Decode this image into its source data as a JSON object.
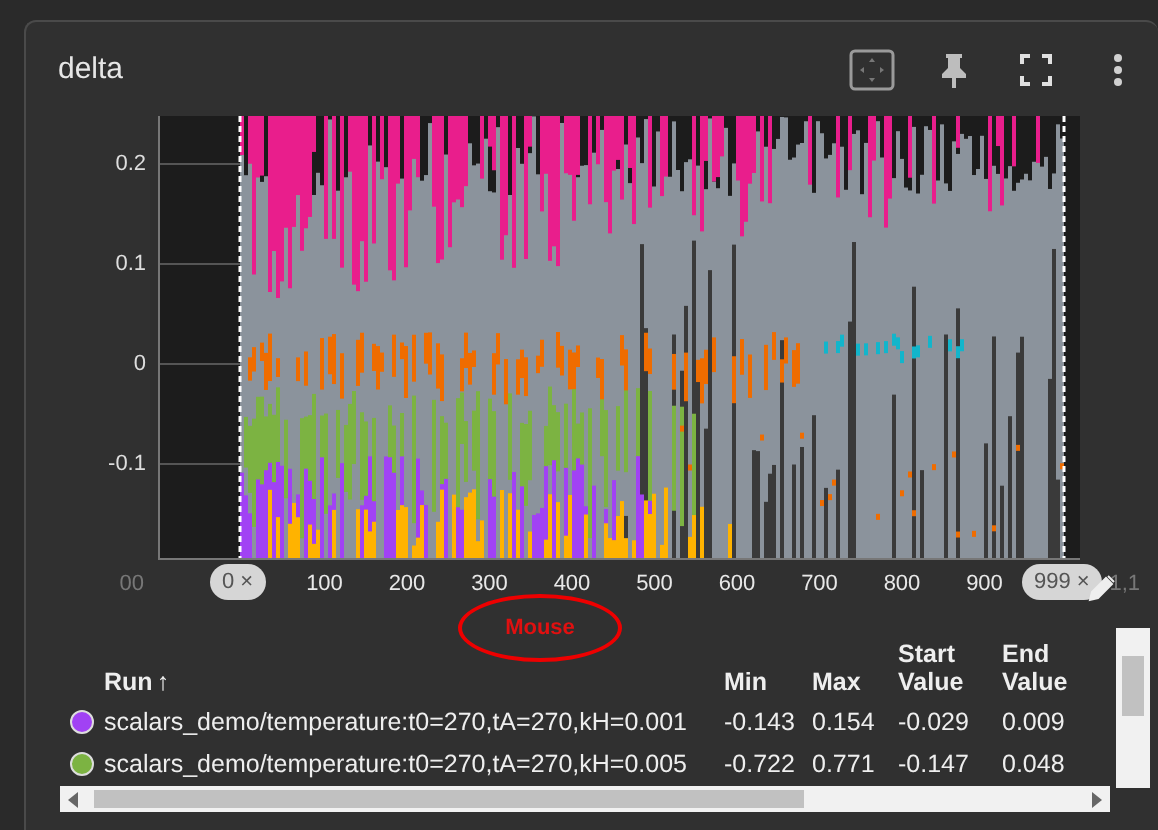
{
  "card": {
    "title": "delta"
  },
  "chart": {
    "y_ticks": [
      "0.2",
      "0.1",
      "0",
      "-0.1"
    ],
    "x_ticks": [
      "00",
      "100",
      "200",
      "300",
      "400",
      "500",
      "600",
      "700",
      "800",
      "900",
      "1,1"
    ],
    "range_start": {
      "label": "0",
      "close": "×"
    },
    "range_end": {
      "label": "999",
      "close": "×"
    },
    "annotation": "Mouse"
  },
  "table": {
    "columns": [
      {
        "label": "Run",
        "sort": "↑"
      },
      {
        "label": "Min"
      },
      {
        "label": "Max"
      },
      {
        "label": "Start Value"
      },
      {
        "label": "End Value"
      }
    ],
    "rows": [
      {
        "color": "#a142f4",
        "run": "scalars_demo/temperature:t0=270,tA=270,kH=0.001",
        "min": "-0.143",
        "max": "0.154",
        "start": "-0.029",
        "end": "0.009"
      },
      {
        "color": "#7cb342",
        "run": "scalars_demo/temperature:t0=270,tA=270,kH=0.005",
        "min": "-0.722",
        "max": "0.771",
        "start": "-0.147",
        "end": "0.048"
      }
    ]
  }
}
